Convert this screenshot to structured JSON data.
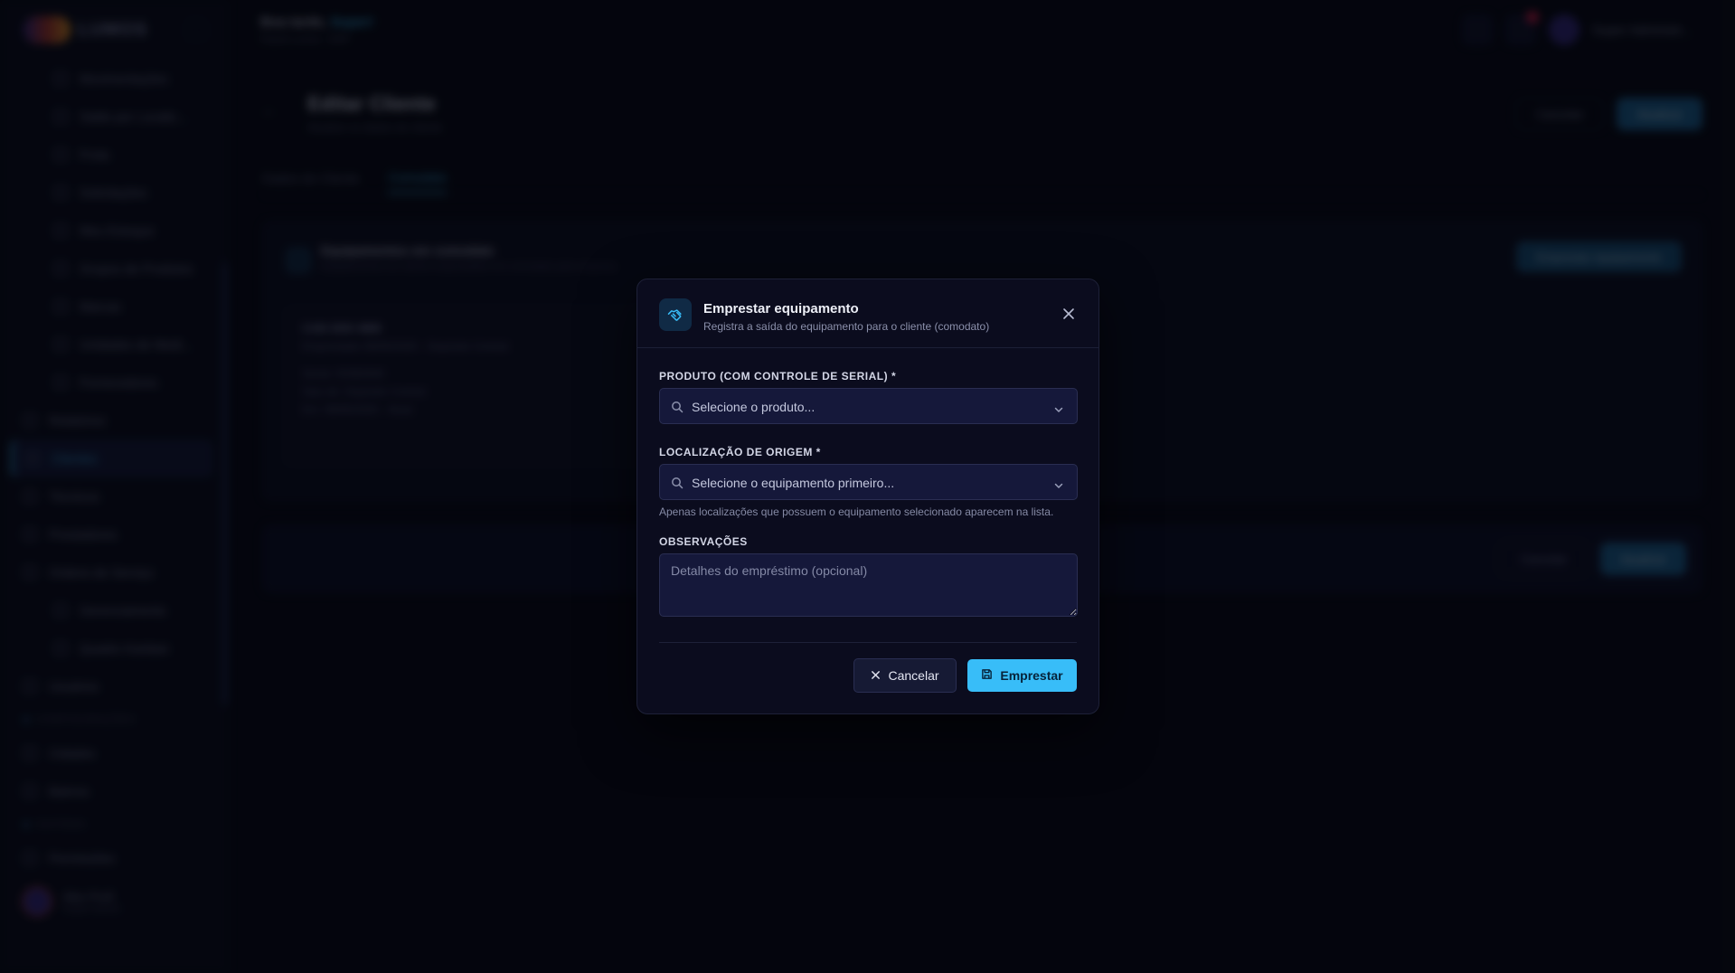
{
  "app": {
    "brand": "LUMOS",
    "greeting_prefix": "Boa tarde,",
    "greeting_name": "Super!",
    "greeting_sub": "Painel Lumos - ERP",
    "top_user": "Super Administr..."
  },
  "sidebar": {
    "items": [
      {
        "label": "Movimentações",
        "sub": true
      },
      {
        "label": "Saldo por Localiz...",
        "sub": true
      },
      {
        "label": "Frota",
        "sub": true
      },
      {
        "label": "Solicitações",
        "sub": true
      },
      {
        "label": "Meu Estoque",
        "sub": true
      },
      {
        "label": "Grupos de Produtos",
        "sub": true
      },
      {
        "label": "Marcas",
        "sub": true
      },
      {
        "label": "Unidades de Medi...",
        "sub": true
      },
      {
        "label": "Fornecedores",
        "sub": true
      },
      {
        "label": "Relatórios",
        "sub": false
      },
      {
        "label": "Clientes",
        "sub": false,
        "active": true
      },
      {
        "label": "Técnicos",
        "sub": false
      },
      {
        "label": "Prestadores",
        "sub": false
      },
      {
        "label": "Ordens de Serviço",
        "sub": false
      },
      {
        "label": "Gerenciamento",
        "sub": true
      },
      {
        "label": "Quadro Kanban",
        "sub": true
      },
      {
        "label": "Usuários",
        "sub": false
      }
    ],
    "section1": "CONFIGURAÇÕES",
    "items2": [
      {
        "label": "Cidades"
      },
      {
        "label": "Bairros"
      }
    ],
    "section2": "SISTEMA",
    "items3": [
      {
        "label": "Permissões"
      }
    ],
    "user_name": "Alex Profi",
    "user_role": "Super Admin"
  },
  "page": {
    "title": "Editar Cliente",
    "subtitle": "Atualize os dados do cliente",
    "cancel": "Cancelar",
    "save": "Atualizar",
    "tabs": [
      "Dados do Cliente",
      "Comodato"
    ],
    "panel_title": "Equipamentos em comodato",
    "panel_sub": "Equipamentos do cliente emprestados em comodato pela empresa",
    "panel_button": "Emprestar equipamento",
    "card_lines": [
      "CAM 3000 4MM",
      "Emprestado 08/05/2025 - Depósito Central",
      "Serial: 00382849",
      "Saiu de: Depósito Central",
      "Em: 08/05/2025 - Atual"
    ]
  },
  "modal": {
    "title": "Emprestar equipamento",
    "subtitle": "Registra a saída do equipamento para o cliente (comodato)",
    "product_label": "PRODUTO (COM CONTROLE DE SERIAL) *",
    "product_placeholder": "Selecione o produto...",
    "location_label": "LOCALIZAÇÃO DE ORIGEM *",
    "location_placeholder": "Selecione o equipamento primeiro...",
    "location_help": "Apenas localizações que possuem o equipamento selecionado aparecem na lista.",
    "notes_label": "OBSERVAÇÕES",
    "notes_placeholder": "Detalhes do empréstimo (opcional)",
    "cancel_label": "Cancelar",
    "submit_label": "Emprestar"
  },
  "colors": {
    "accent": "#38bdf8",
    "background": "#06070f",
    "modal_bg": "#0b0c1e",
    "input_bg": "#15183a"
  }
}
